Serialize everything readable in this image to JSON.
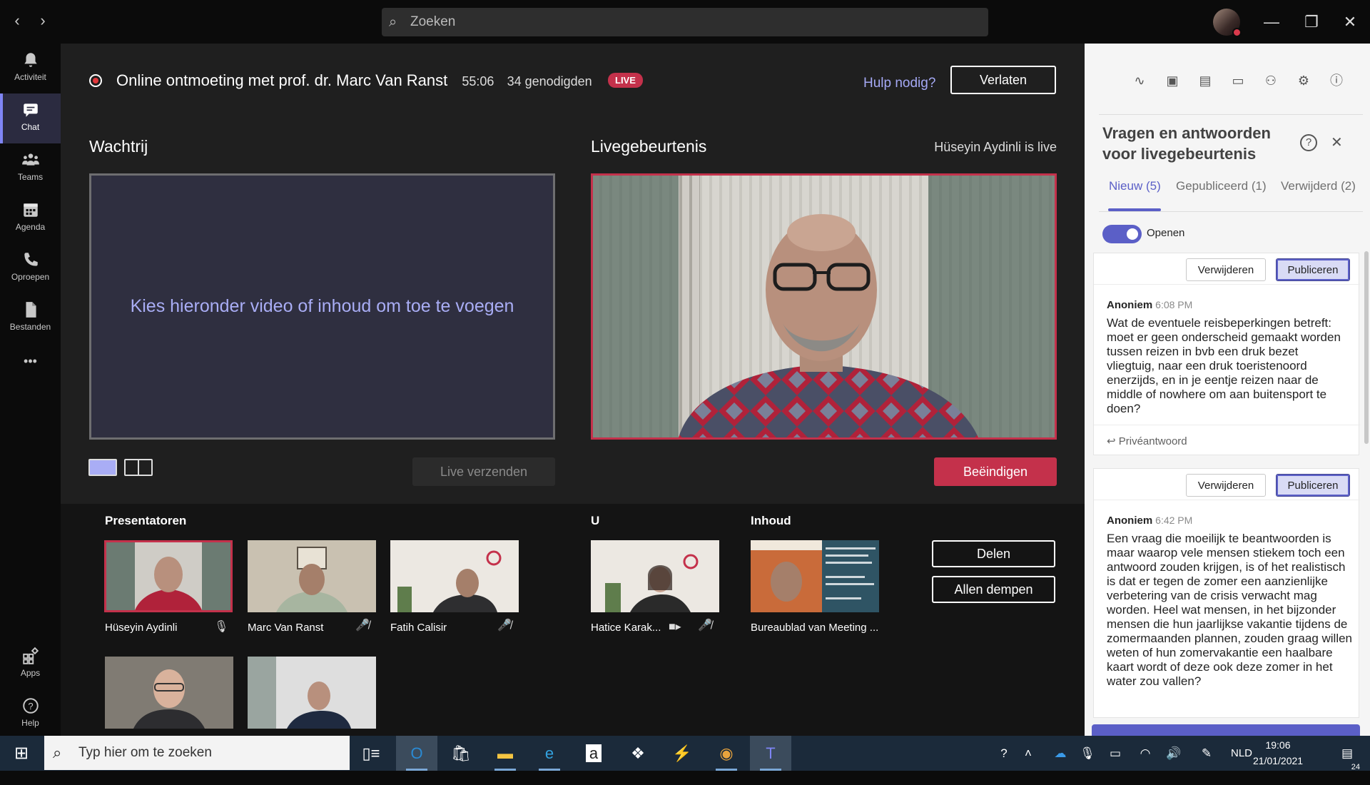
{
  "titlebar": {
    "search_placeholder": "Zoeken",
    "back_glyph": "‹",
    "forward_glyph": "›",
    "minimize_glyph": "—",
    "maximize_glyph": "❐",
    "close_glyph": "✕"
  },
  "rail": {
    "items": [
      {
        "label": "Activiteit",
        "icon": "bell-icon"
      },
      {
        "label": "Chat",
        "icon": "chat-icon"
      },
      {
        "label": "Teams",
        "icon": "teams-icon"
      },
      {
        "label": "Agenda",
        "icon": "calendar-icon"
      },
      {
        "label": "Oproepen",
        "icon": "phone-icon"
      },
      {
        "label": "Bestanden",
        "icon": "file-icon"
      }
    ],
    "more_label": "•••",
    "apps_label": "Apps",
    "help_label": "Help"
  },
  "meeting": {
    "title": "Online ontmoeting met prof. dr. Marc Van Ranst",
    "duration": "55:06",
    "attendees": "34 genodigden",
    "live_badge": "LIVE",
    "help_link": "Hulp nodig?",
    "leave_label": "Verlaten"
  },
  "queue": {
    "title": "Wachtrij",
    "placeholder": "Kies hieronder video of inhoud om toe te voegen",
    "send_live_label": "Live verzenden"
  },
  "live": {
    "title": "Livegebeurtenis",
    "status": "Hüseyin Aydinli is live",
    "end_label": "Beëindigen"
  },
  "presenters": {
    "title": "Presentatoren",
    "people": [
      {
        "name": "Hüseyin Aydinli",
        "mic": "mic-on"
      },
      {
        "name": "Marc Van Ranst",
        "mic": "mic-off"
      },
      {
        "name": "Fatih Calisir",
        "mic": "mic-off"
      }
    ]
  },
  "you": {
    "title": "U",
    "name": "Hatice Karak...",
    "mic": "mic-off"
  },
  "content": {
    "title": "Inhoud",
    "name": "Bureaublad van Meeting ..."
  },
  "actions": {
    "share_label": "Delen",
    "mute_all_label": "Allen dempen"
  },
  "qa": {
    "title": "Vragen en antwoorden voor livegebeurtenis",
    "tabs": [
      "Nieuw (5)",
      "Gepubliceerd (1)",
      "Verwijderd (2)"
    ],
    "toggle_label": "Openen",
    "delete_label": "Verwijderen",
    "publish_label": "Publiceren",
    "private_reply_label": "Privéantwoord",
    "questions": [
      {
        "author": "Anoniem",
        "time": "6:08 PM",
        "text": "Wat de eventuele reisbeperkingen betreft: moet er geen onderscheid gemaakt worden tussen reizen in bvb een druk bezet vliegtuig, naar een druk toeristenoord enerzijds, en in je eentje reizen naar de middle of nowhere om aan buitensport te doen?"
      },
      {
        "author": "Anoniem",
        "time": "6:42 PM",
        "text": "Een vraag die moeilijk te beantwoorden is maar waarop vele mensen stiekem toch een antwoord zouden krijgen, is of het realistisch is dat er tegen de zomer een aanzienlijke verbetering van de crisis verwacht mag worden. Heel wat mensen, in het bijzonder mensen die hun jaarlijkse vakantie tijdens de zomermaanden plannen, zouden graag willen weten of hun zomervakantie een haalbare kaart wordt of deze ook deze zomer in het water zou vallen?"
      }
    ]
  },
  "taskbar": {
    "search_placeholder": "Typ hier om te zoeken",
    "language": "NLD",
    "time": "19:06",
    "date": "21/01/2021",
    "notifications": "24"
  },
  "colors": {
    "accent": "#5b5fc7",
    "live_red": "#c4314b",
    "stage_bg": "#1f1f1f"
  }
}
